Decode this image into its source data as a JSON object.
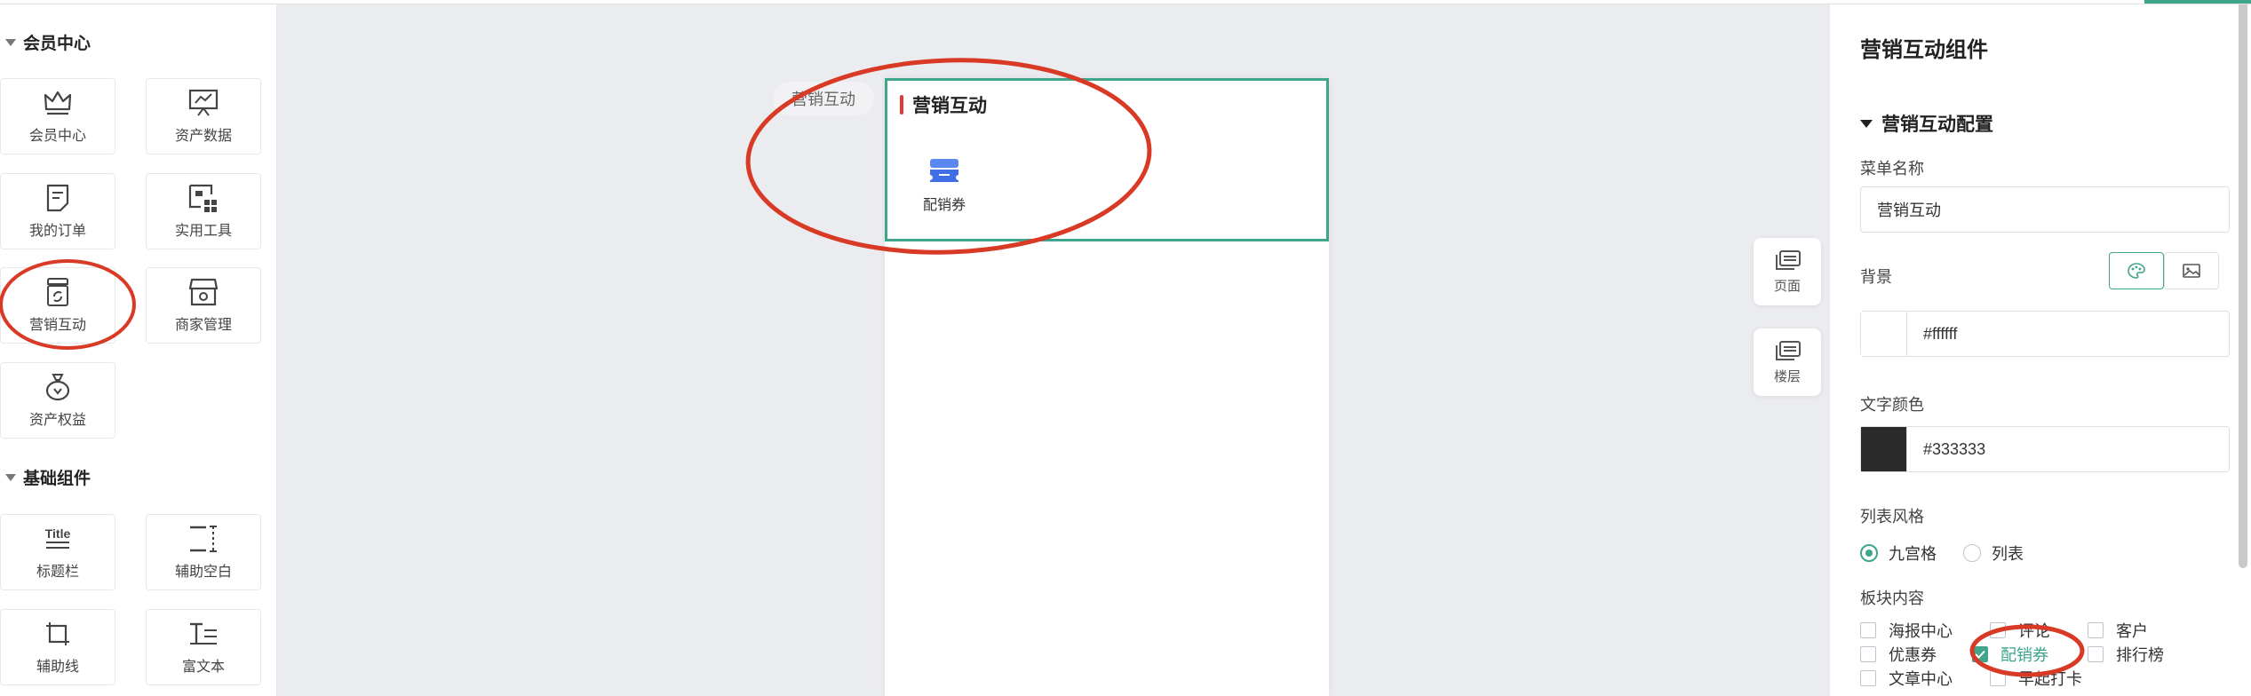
{
  "left_panel": {
    "groups": [
      {
        "title": "会员中心",
        "items": [
          {
            "label": "会员中心",
            "icon": "crown-icon"
          },
          {
            "label": "资产数据",
            "icon": "chart-board-icon"
          },
          {
            "label": "我的订单",
            "icon": "order-icon"
          },
          {
            "label": "实用工具",
            "icon": "tools-icon"
          },
          {
            "label": "营销互动",
            "icon": "marketing-icon"
          },
          {
            "label": "商家管理",
            "icon": "shop-icon"
          },
          {
            "label": "资产权益",
            "icon": "money-bag-icon"
          }
        ]
      },
      {
        "title": "基础组件",
        "items": [
          {
            "label": "标题栏",
            "icon": "title-icon",
            "icon_text": "Title"
          },
          {
            "label": "辅助空白",
            "icon": "blank-icon"
          },
          {
            "label": "辅助线",
            "icon": "guide-line-icon"
          },
          {
            "label": "富文本",
            "icon": "rich-text-icon"
          }
        ]
      }
    ]
  },
  "canvas": {
    "tag": "营销互动",
    "block_title": "营销互动",
    "block_items": [
      {
        "label": "配销券",
        "icon": "coupon-icon"
      }
    ]
  },
  "float_buttons": [
    {
      "label": "页面",
      "icon": "page-icon"
    },
    {
      "label": "楼层",
      "icon": "floor-icon"
    }
  ],
  "right_panel": {
    "title": "营销互动组件",
    "section": "营销互动配置",
    "menu_name_label": "菜单名称",
    "menu_name_value": "营销互动",
    "background_label": "背景",
    "background_value": "#ffffff",
    "text_color_label": "文字颜色",
    "text_color_value": "#333333",
    "list_style_label": "列表风格",
    "list_styles": [
      {
        "label": "九宫格",
        "selected": true
      },
      {
        "label": "列表",
        "selected": false
      }
    ],
    "content_label": "板块内容",
    "content_items": [
      {
        "label": "海报中心",
        "checked": false
      },
      {
        "label": "评论",
        "checked": false
      },
      {
        "label": "客户",
        "checked": false
      },
      {
        "label": "优惠券",
        "checked": false
      },
      {
        "label": "配销券",
        "checked": true
      },
      {
        "label": "排行榜",
        "checked": false
      },
      {
        "label": "文章中心",
        "checked": false
      },
      {
        "label": "早起打卡",
        "checked": false
      }
    ]
  },
  "colors": {
    "accent": "#3fa58b",
    "annotation": "#d93a26",
    "title_bar": "#e4393c",
    "text_color_swatch": "#333333"
  }
}
